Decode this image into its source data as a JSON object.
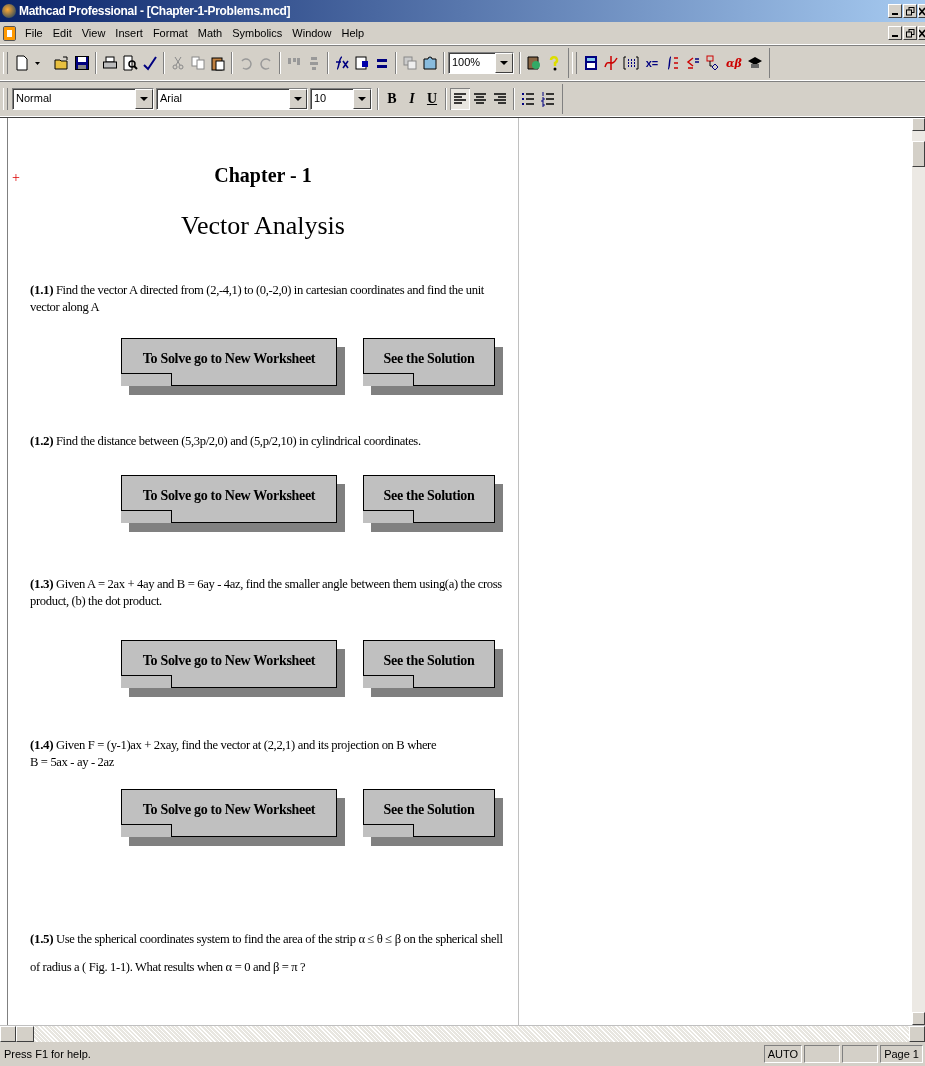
{
  "window": {
    "title": "Mathcad Professional - [Chapter-1-Problems.mcd]"
  },
  "menu": [
    "File",
    "Edit",
    "View",
    "Insert",
    "Format",
    "Math",
    "Symbolics",
    "Window",
    "Help"
  ],
  "toolbar": {
    "zoom": "100%",
    "equals_label": "x=",
    "greek_label": "αβ"
  },
  "format_bar": {
    "style": "Normal",
    "font": "Arial",
    "size": "10",
    "bold": "B",
    "italic": "I",
    "underline": "U"
  },
  "document": {
    "marker": "+",
    "heading": "Chapter - 1",
    "title": "Vector Analysis",
    "problems": [
      {
        "text": "**(1.1)** Find the vector A directed from (2,-4,1) to (0,-2,0) in cartesian coordinates and find the unit vector along A",
        "buttons": [
          "To Solve go to New Worksheet",
          "See the Solution"
        ]
      },
      {
        "text": "**(1.2)** Find the distance between (5,3p/2,0) and (5,p/2,10) in cylindrical coordinates.",
        "buttons": [
          "To Solve go to New Worksheet",
          "See the Solution"
        ]
      },
      {
        "text": "**(1.3)** Given A = 2ax + 4ay and B = 6ay - 4az, find the smaller angle between them using(a) the cross product, (b) the dot product.",
        "buttons": [
          "To Solve go to New Worksheet",
          "See the Solution"
        ]
      },
      {
        "text": "**(1.4)** Given F = (y-1)ax + 2xay, find the vector at (2,2,1) and its projection on B where\nB = 5ax - ay - 2az",
        "buttons": [
          "To Solve go to New Worksheet",
          "See the Solution"
        ]
      },
      {
        "text": "**(1.5)** Use the spherical coordinates system to find the area of the strip α ≤ θ ≤ β on the spherical shell of radius a ( Fig. 1-1). What results when α = 0 and  β = π ?"
      }
    ]
  },
  "status_bar": {
    "message": "Press F1 for help.",
    "mode": "AUTO",
    "page": "Page 1"
  }
}
